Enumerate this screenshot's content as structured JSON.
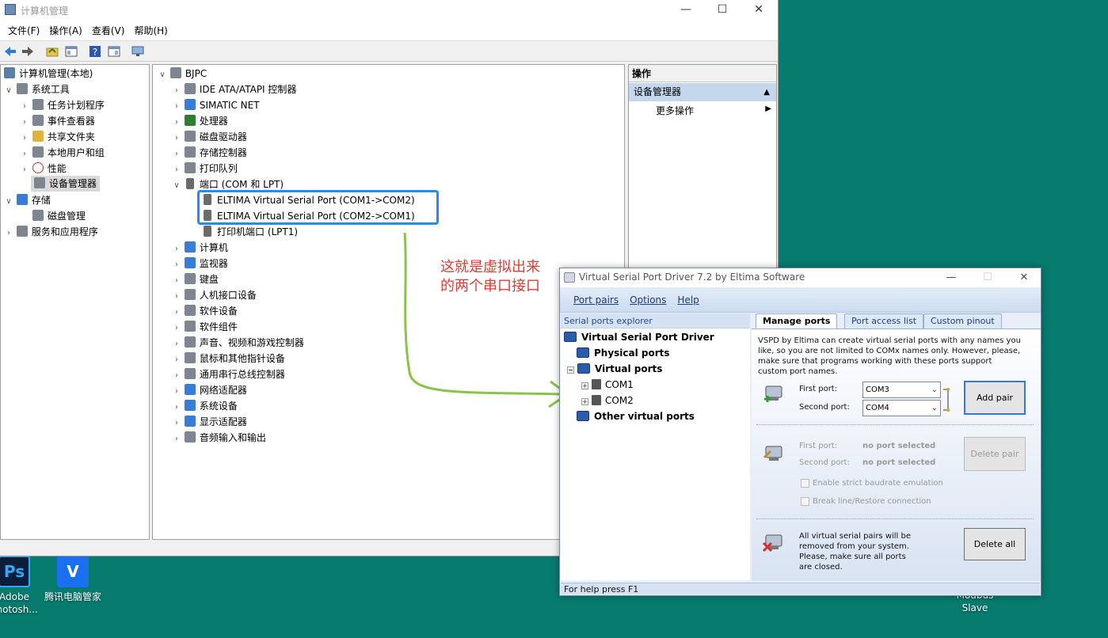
{
  "desktop": {
    "icons": [
      {
        "label": "Adobe\nPhotosh...",
        "glyph": "Ps"
      },
      {
        "label": "腾讯电脑管家",
        "glyph": "V"
      },
      {
        "label": "Modbus\nSlave",
        "glyph": ""
      }
    ]
  },
  "cm": {
    "title": "计算机管理",
    "menu": [
      "文件(F)",
      "操作(A)",
      "查看(V)",
      "帮助(H)"
    ],
    "left_tree": [
      {
        "label": "计算机管理(本地)",
        "level": 0
      },
      {
        "label": "系统工具",
        "level": 1,
        "expanded": true
      },
      {
        "label": "任务计划程序",
        "level": 2
      },
      {
        "label": "事件查看器",
        "level": 2
      },
      {
        "label": "共享文件夹",
        "level": 2
      },
      {
        "label": "本地用户和组",
        "level": 2
      },
      {
        "label": "性能",
        "level": 2
      },
      {
        "label": "设备管理器",
        "level": 2,
        "selected": true
      },
      {
        "label": "存储",
        "level": 1,
        "expanded": true
      },
      {
        "label": "磁盘管理",
        "level": 2
      },
      {
        "label": "服务和应用程序",
        "level": 1
      }
    ],
    "device_tree": {
      "root": "BJPC",
      "items": [
        "IDE ATA/ATAPI 控制器",
        "SIMATIC NET",
        "处理器",
        "磁盘驱动器",
        "存储控制器",
        "打印队列",
        "端口 (COM 和 LPT)",
        "ELTIMA Virtual Serial Port (COM1->COM2)",
        "ELTIMA Virtual Serial Port (COM2->COM1)",
        "打印机端口 (LPT1)",
        "计算机",
        "监视器",
        "键盘",
        "人机接口设备",
        "软件设备",
        "软件组件",
        "声音、视频和游戏控制器",
        "鼠标和其他指针设备",
        "通用串行总线控制器",
        "网络适配器",
        "系统设备",
        "显示适配器",
        "音频输入和输出"
      ]
    },
    "actions": {
      "header": "操作",
      "section": "设备管理器",
      "more": "更多操作"
    }
  },
  "annotation": {
    "line1": "这就是虚拟出来",
    "line2": "的两个串口接口"
  },
  "vspd": {
    "title": "Virtual Serial Port Driver 7.2 by Eltima Software",
    "menu": [
      "Port pairs",
      "Options",
      "Help"
    ],
    "explorer_header": "Serial ports explorer",
    "tree": {
      "root": "Virtual Serial Port Driver",
      "physical": "Physical ports",
      "virtual": "Virtual ports",
      "com1": "COM1",
      "com2": "COM2",
      "other": "Other virtual ports"
    },
    "tabs": [
      "Manage ports",
      "Port access list",
      "Custom pinout"
    ],
    "description": "VSPD by Eltima can create virtual serial ports with any names you like, so you are not limited to COMx names only. However, please, make sure that programs working with these ports support custom port names.",
    "add": {
      "first_label": "First port:",
      "first_value": "COM3",
      "second_label": "Second port:",
      "second_value": "COM4",
      "button": "Add pair"
    },
    "delete": {
      "first_label": "First port:",
      "first_value": "no port selected",
      "second_label": "Second port:",
      "second_value": "no port selected",
      "button": "Delete pair",
      "strict": "Enable strict baudrate emulation",
      "breakline": "Break line/Restore connection"
    },
    "delete_all": {
      "text": "All virtual serial pairs will be removed from your system. Please, make sure all ports are closed.",
      "button": "Delete all"
    },
    "status": "For help press F1"
  }
}
